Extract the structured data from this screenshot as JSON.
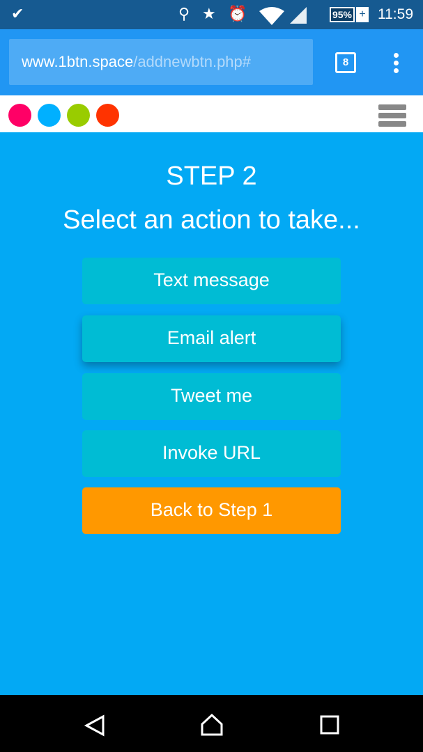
{
  "status_bar": {
    "time": "11:59",
    "battery": "95%",
    "battery_plus": "+"
  },
  "browser": {
    "url_domain": "www.1btn.space",
    "url_path": "/addnewbtn.php#",
    "tab_count": "8"
  },
  "site_nav": {
    "dot_colors": [
      "#ff0066",
      "#00b0ff",
      "#99cc00",
      "#ff3300"
    ]
  },
  "main": {
    "step": "STEP 2",
    "subtitle": "Select an action to take...",
    "buttons": [
      {
        "label": "Text message"
      },
      {
        "label": "Email alert"
      },
      {
        "label": "Tweet me"
      },
      {
        "label": "Invoke URL"
      },
      {
        "label": "Back to Step 1"
      }
    ]
  },
  "colors": {
    "background": "#03a9f4",
    "action_button": "#00bcd4",
    "back_button": "#ff9800"
  }
}
